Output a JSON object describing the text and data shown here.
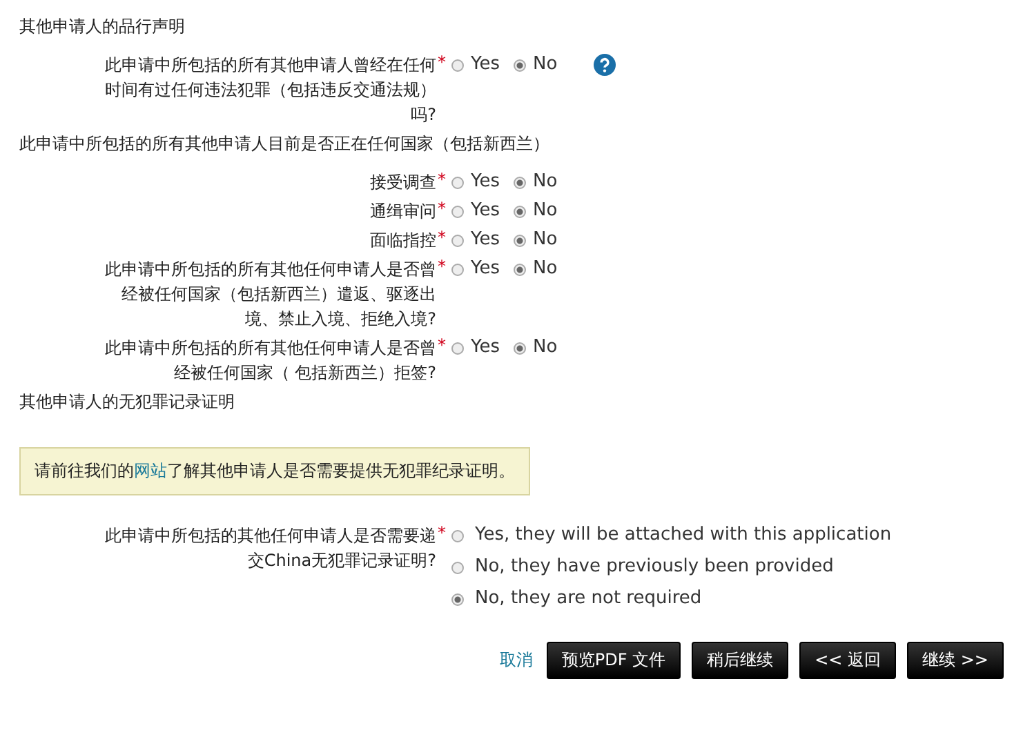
{
  "form": [
    {
      "kind": "heading",
      "text": "其他申请人的品行声明"
    },
    {
      "kind": "question",
      "label": "此申请中所包括的所有其他申请人曾经在任何时间有过任何违法犯罪（包括违反交通法规）吗?",
      "required_mark": "*",
      "help": true,
      "options": [
        {
          "label": "Yes",
          "selected": false
        },
        {
          "label": "No",
          "selected": true
        }
      ]
    },
    {
      "kind": "heading",
      "text": "此申请中所包括的所有其他申请人目前是否正在任何国家（包括新西兰）"
    },
    {
      "kind": "question",
      "label": "接受调查",
      "required_mark": "*",
      "options": [
        {
          "label": "Yes",
          "selected": false
        },
        {
          "label": "No",
          "selected": true
        }
      ]
    },
    {
      "kind": "question",
      "label": "通缉审问",
      "required_mark": "*",
      "options": [
        {
          "label": "Yes",
          "selected": false
        },
        {
          "label": "No",
          "selected": true
        }
      ]
    },
    {
      "kind": "question",
      "label": "面临指控",
      "required_mark": "*",
      "options": [
        {
          "label": "Yes",
          "selected": false
        },
        {
          "label": "No",
          "selected": true
        }
      ]
    },
    {
      "kind": "question",
      "label": "此申请中所包括的所有其他任何申请人是否曾经被任何国家（包括新西兰）遣返、驱逐出境、禁止入境、拒绝入境?",
      "required_mark": "*",
      "options": [
        {
          "label": "Yes",
          "selected": false
        },
        {
          "label": "No",
          "selected": true
        }
      ]
    },
    {
      "kind": "question",
      "label": "此申请中所包括的所有其他任何申请人是否曾经被任何国家（ 包括新西兰）拒签?",
      "required_mark": "*",
      "options": [
        {
          "label": "Yes",
          "selected": false
        },
        {
          "label": "No",
          "selected": true
        }
      ]
    },
    {
      "kind": "heading",
      "text": "其他申请人的无犯罪记录证明"
    },
    {
      "kind": "notice",
      "before": "请前往我们的",
      "link": "网站",
      "after": "了解其他申请人是否需要提供无犯罪纪录证明。"
    },
    {
      "kind": "question_list",
      "label": "此申请中所包括的其他任何申请人是否需要递交China无犯罪记录证明?",
      "required_mark": "*",
      "options": [
        {
          "label": "Yes, they will be attached with this application",
          "selected": false
        },
        {
          "label": "No, they have previously been provided",
          "selected": false
        },
        {
          "label": "No, they are not required",
          "selected": true
        }
      ]
    }
  ],
  "cancel_link": "取消",
  "buttons": [
    "预览PDF 文件",
    "稍后继续",
    "<< 返回",
    "继续 >>"
  ]
}
